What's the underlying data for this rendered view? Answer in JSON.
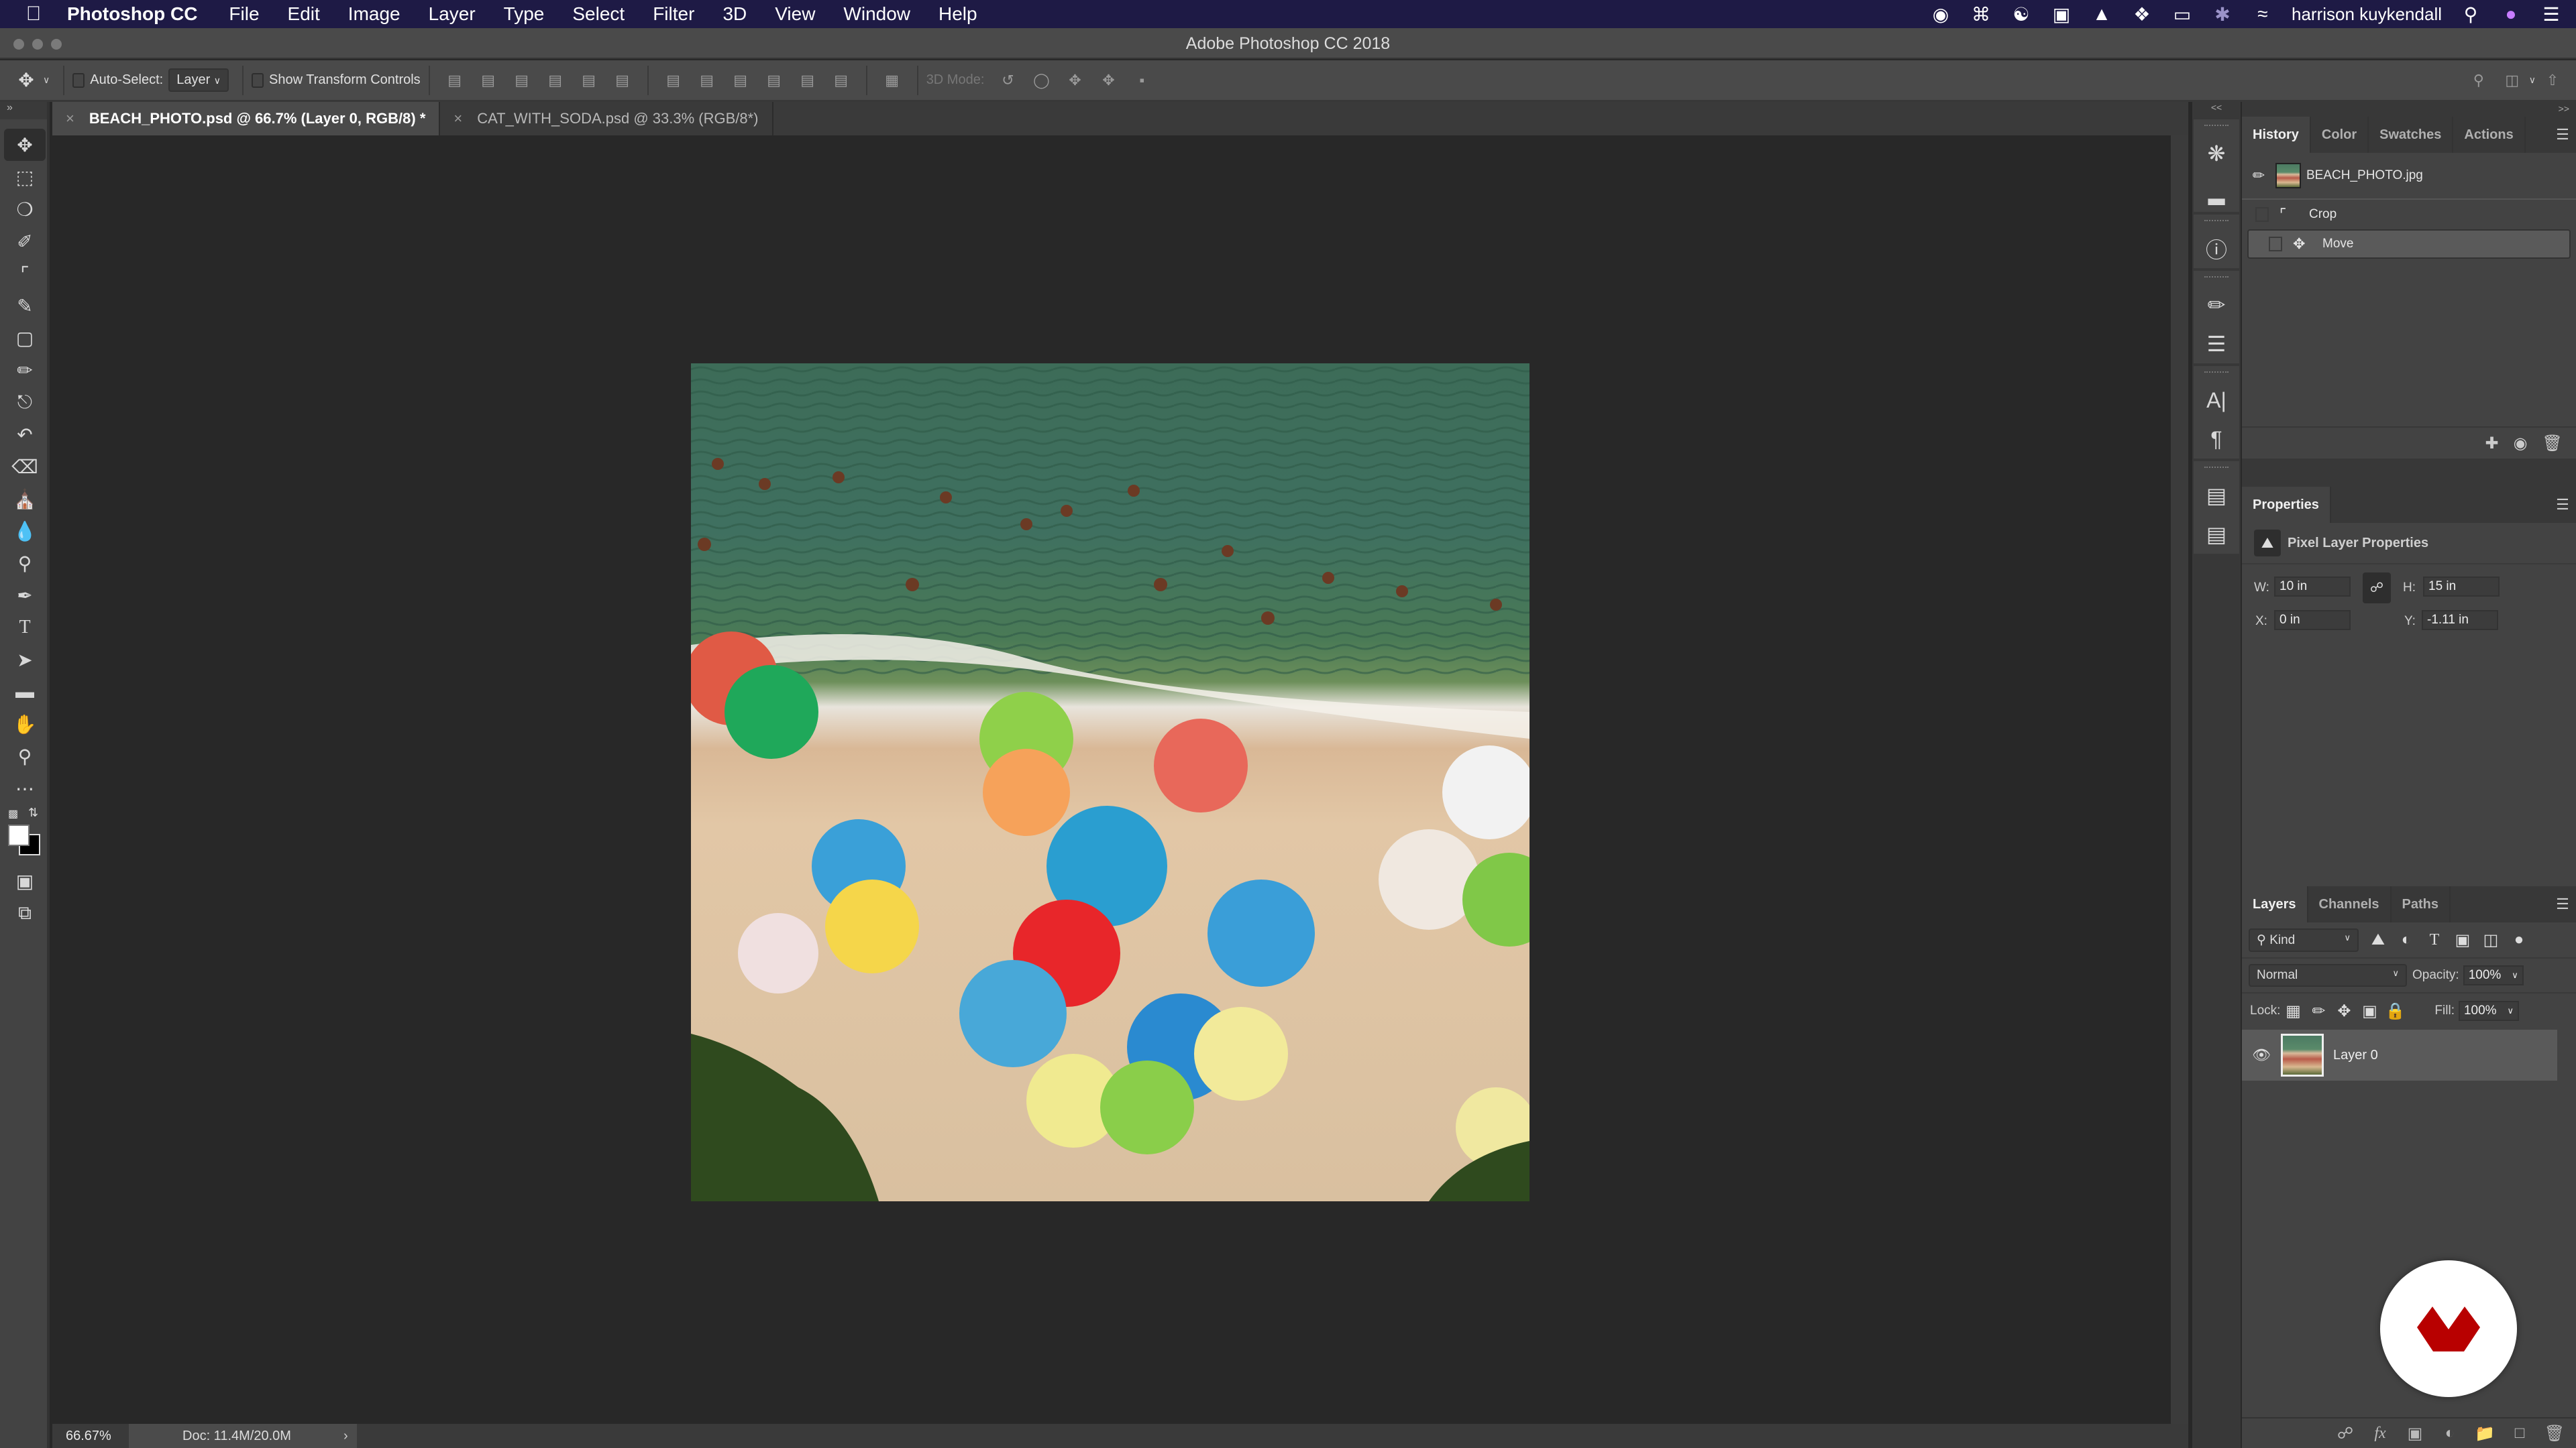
{
  "menubar": {
    "app_name": "Photoshop CC",
    "items": [
      "File",
      "Edit",
      "Image",
      "Layer",
      "Type",
      "Select",
      "Filter",
      "3D",
      "View",
      "Window",
      "Help"
    ],
    "user_name": "harrison kuykendall"
  },
  "window": {
    "title": "Adobe Photoshop CC 2018"
  },
  "options_bar": {
    "auto_select_label": "Auto-Select:",
    "auto_select_value": "Layer",
    "auto_select_checked": false,
    "show_transform_label": "Show Transform Controls",
    "show_transform_checked": false,
    "mode_3d_label": "3D Mode:"
  },
  "doc_tabs": [
    {
      "label": "BEACH_PHOTO.psd @ 66.7% (Layer 0, RGB/8) *",
      "active": true
    },
    {
      "label": "CAT_WITH_SODA.psd @ 33.3% (RGB/8*)",
      "active": false
    }
  ],
  "tools": [
    "move",
    "rectangular-marquee",
    "lasso",
    "quick-selection",
    "crop",
    "eyedropper",
    "spot-healing-brush",
    "brush",
    "clone-stamp",
    "history-brush",
    "eraser",
    "paint-bucket",
    "blur",
    "dodge",
    "pen",
    "type",
    "path-selection",
    "rectangle",
    "hand",
    "zoom",
    "edit-toolbar"
  ],
  "colors": {
    "foreground": "#ffffff",
    "background": "#000000",
    "accent_badge": "#b80000"
  },
  "status": {
    "zoom": "66.67%",
    "doc": "Doc: 11.4M/20.0M"
  },
  "history_panel": {
    "tabs": [
      "History",
      "Color",
      "Swatches",
      "Actions"
    ],
    "snapshot": "BEACH_PHOTO.jpg",
    "states": [
      {
        "label": "Crop",
        "icon": "crop-icon",
        "selected": false
      },
      {
        "label": "Move",
        "icon": "move-icon",
        "selected": true
      }
    ]
  },
  "properties_panel": {
    "title": "Properties",
    "subtitle": "Pixel Layer Properties",
    "w_label": "W:",
    "w_value": "10 in",
    "h_label": "H:",
    "h_value": "15 in",
    "x_label": "X:",
    "x_value": "0 in",
    "y_label": "Y:",
    "y_value": "-1.11 in"
  },
  "layers_panel": {
    "tabs": [
      "Layers",
      "Channels",
      "Paths"
    ],
    "filter_kind": "Kind",
    "blend_mode": "Normal",
    "opacity_label": "Opacity:",
    "opacity": "100%",
    "lock_label": "Lock:",
    "fill_label": "Fill:",
    "fill": "100%",
    "layers": [
      {
        "name": "Layer 0",
        "visible": true,
        "selected": true
      }
    ]
  }
}
